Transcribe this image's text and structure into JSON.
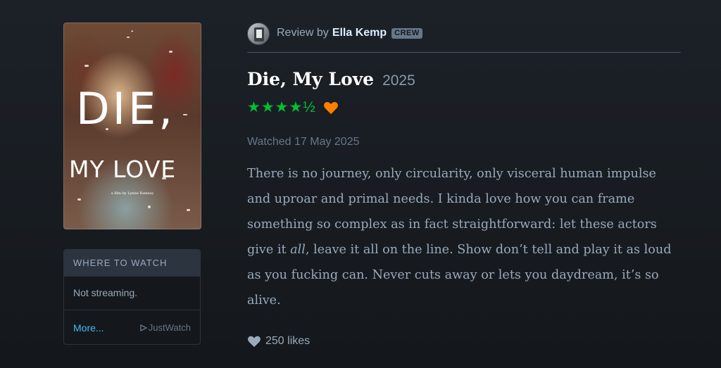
{
  "poster": {
    "title_line1": "DIE,",
    "title_line2": "MY LOVE",
    "credit": "a film by Lynne Ramsay"
  },
  "where_to_watch": {
    "heading": "WHERE TO WATCH",
    "status": "Not streaming.",
    "more_label": "More...",
    "provider": "JustWatch"
  },
  "review": {
    "prefix": "Review by",
    "reviewer": "Ella Kemp",
    "badge": "CREW",
    "film_title": "Die, My Love",
    "year": "2025",
    "rating_stars": "★★★★½",
    "rating_value": 4.5,
    "liked": true,
    "watched": "Watched 17 May 2025",
    "text_part1": "There is no journey, only circularity, only visceral human impulse and uproar and primal needs. I kinda love how you can frame something so complex as in fact straightforward: let these actors give it ",
    "text_emphasis": "all",
    "text_part2": ", leave it all on the line. Show don’t tell and play it as loud as you fucking can. Never cuts away or lets you daydream, it’s so alive.",
    "likes": "250 likes"
  },
  "colors": {
    "background": "#14181c",
    "star_green": "#00c030",
    "heart_orange": "#ff8000",
    "link_blue": "#40bcf4"
  }
}
